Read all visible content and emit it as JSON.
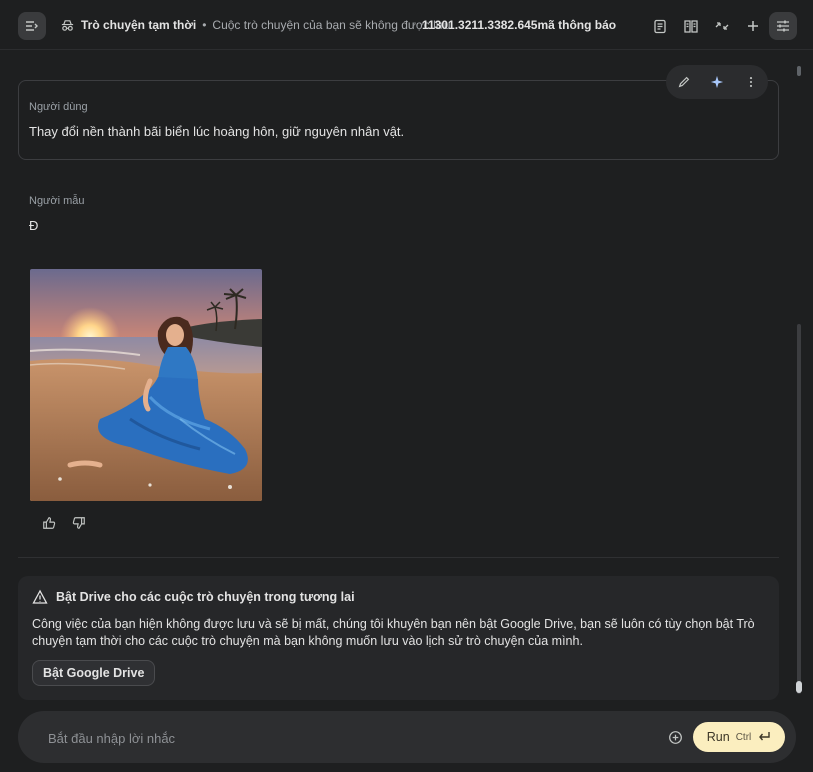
{
  "header": {
    "title": "Trò chuyện tạm thời",
    "subtitle": "Cuộc trò chuyện của bạn sẽ không được lưu",
    "tokens": "11301.3211.3382.645mã thông báo",
    "icons": [
      "menu-collapse-icon",
      "incognito-icon",
      "clipboard-icon",
      "book-icon",
      "compare-icon",
      "plus-icon",
      "tune-icon"
    ]
  },
  "user_message": {
    "role": "Người dùng",
    "text": "Thay đổi nền thành bãi biển lúc hoàng hôn, giữ nguyên nhân vật."
  },
  "message_toolbar": {
    "icons": [
      "edit-icon",
      "sparkle-icon",
      "more-vert-icon"
    ]
  },
  "model_message": {
    "role": "Người mẫu",
    "text": "Đ",
    "image": "woman in blue dress sitting on beach at sunset",
    "feedback_icons": [
      "thumb-up-icon",
      "thumb-down-icon"
    ]
  },
  "drive_notice": {
    "title": "Bật Drive cho các cuộc trò chuyện trong tương lai",
    "body": "Công việc của bạn hiện không được lưu và sẽ bị mất, chúng tôi khuyên bạn nên bật Google Drive, bạn sẽ luôn có tùy chọn bật Trò chuyện tạm thời cho các cuộc trò chuyện mà bạn không muốn lưu vào lịch sử trò chuyện của mình.",
    "button": "Bật Google Drive",
    "icon": "warning-icon"
  },
  "prompt": {
    "placeholder": "Bắt đầu nhập lời nhắc",
    "run_label": "Run",
    "shortcut": "Ctrl",
    "icons": [
      "add-circle-icon",
      "enter-icon"
    ]
  },
  "colors": {
    "background": "#1e1f20",
    "run_button": "#fbeebf",
    "card_border": "#3c3d40"
  }
}
